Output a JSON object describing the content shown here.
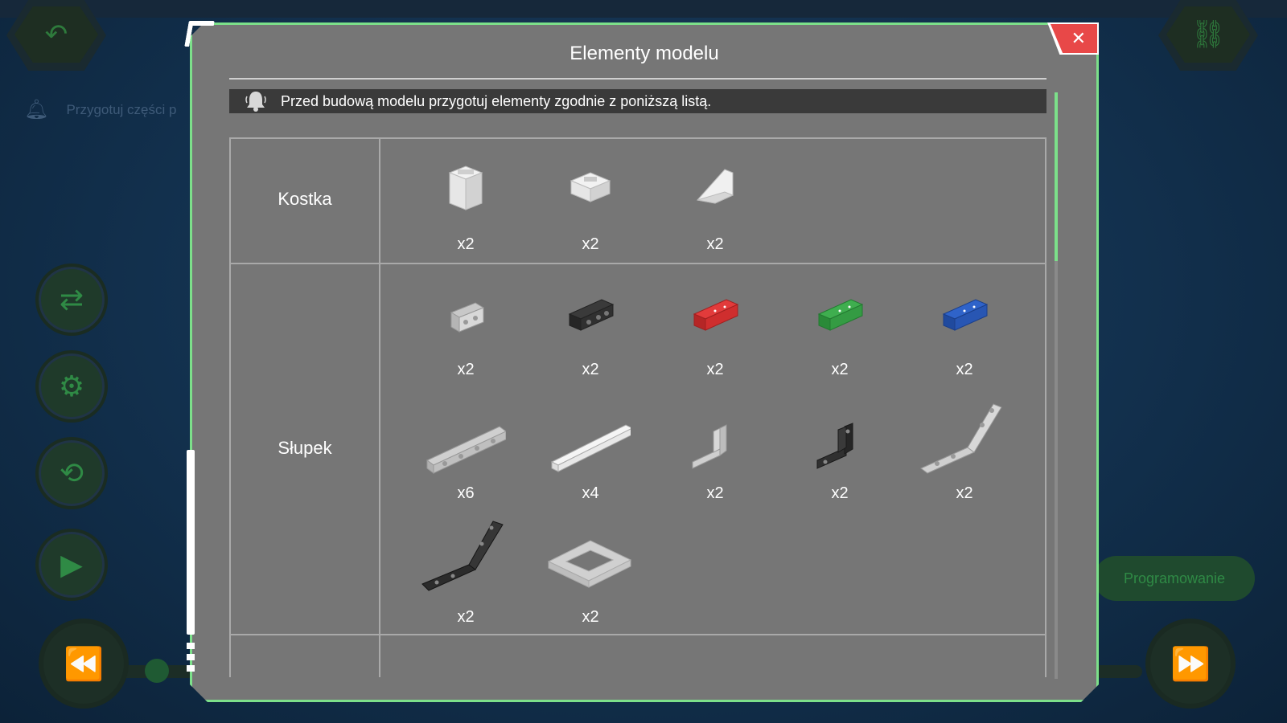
{
  "background": {
    "hint_text": "Przygotuj części p",
    "program_button": "Programowanie"
  },
  "modal": {
    "title": "Elementy modelu",
    "notice": "Przed budową modelu przygotuj elementy zgodnie z poniższą listą.",
    "close_symbol": "✕",
    "accent_color": "#7ce08a",
    "categories": [
      {
        "label": "Kostka",
        "items": [
          {
            "icon": "white-cube-block-icon",
            "qty": "x2"
          },
          {
            "icon": "white-half-cube-block-icon",
            "qty": "x2"
          },
          {
            "icon": "white-wedge-block-icon",
            "qty": "x2"
          }
        ]
      },
      {
        "label": "Słupek",
        "items": [
          {
            "icon": "gray-short-beam-icon",
            "qty": "x2"
          },
          {
            "icon": "black-short-beam-icon",
            "qty": "x2"
          },
          {
            "icon": "red-short-beam-icon",
            "qty": "x2"
          },
          {
            "icon": "green-short-beam-icon",
            "qty": "x2"
          },
          {
            "icon": "blue-short-beam-icon",
            "qty": "x2"
          },
          {
            "icon": "gray-long-beam-icon",
            "qty": "x6"
          },
          {
            "icon": "white-long-beam-icon",
            "qty": "x4"
          },
          {
            "icon": "gray-l-beam-icon",
            "qty": "x2"
          },
          {
            "icon": "black-l-beam-icon",
            "qty": "x2"
          },
          {
            "icon": "gray-angled-beam-icon",
            "qty": "x2"
          },
          {
            "icon": "black-angled-beam-icon",
            "qty": "x2"
          },
          {
            "icon": "white-frame-icon",
            "qty": "x2"
          }
        ]
      }
    ]
  }
}
